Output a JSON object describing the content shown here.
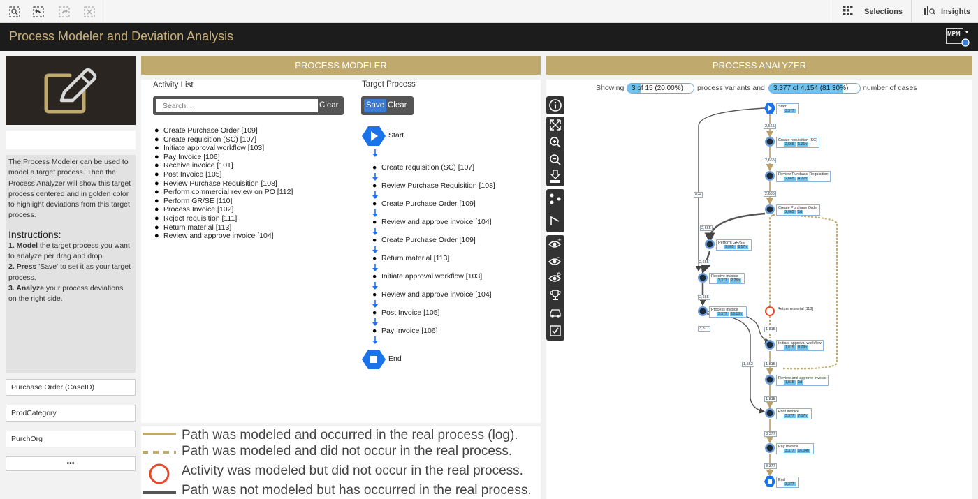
{
  "toolbar": {
    "icons": [
      "smart-search-icon",
      "step-back-icon",
      "step-forward-icon",
      "clear-selections-icon"
    ],
    "selections_label": "Selections",
    "insights_label": "Insights"
  },
  "header": {
    "title": "Process Modeler and Deviation Analysis",
    "logo_text": "MPM"
  },
  "left": {
    "description": "The Process Modeler can be used to model a target process. Then the Process Analyzer will show this target process centered and in golden color to highlight deviations from this target process.",
    "instructions_heading": "Instructions:",
    "steps": [
      {
        "bold": "1. Model",
        "rest": " the target process you want to analyze per drag and drop."
      },
      {
        "bold": "2. Press",
        "rest": " 'Save' to set it as your target process."
      },
      {
        "bold": "3. Analyze",
        "rest": " your process deviations on the right side."
      }
    ],
    "filters": [
      "Purchase Order (CaseID)",
      "ProdCategory",
      "PurchOrg"
    ],
    "more_label": "•••"
  },
  "modeler": {
    "header": "PROCESS MODELER",
    "activity_list_label": "Activity List",
    "search_placeholder": "Search...",
    "search_clear": "Clear",
    "activities": [
      "Create Purchase Order [109]",
      "Create requisition (SC) [107]",
      "Initiate approval workflow [103]",
      "Pay Invoice [106]",
      "Receive invoice [101]",
      "Post Invoice [105]",
      "Review Purchase Requisition [108]",
      "Perform commercial review on PO [112]",
      "Perform GR/SE [110]",
      "Process Invoice [102]",
      "Reject requisition [111]",
      "Return material [113]",
      "Review and approve invoice [104]"
    ],
    "target_label": "Target Process",
    "save_label": "Save",
    "clear_label": "Clear",
    "start_label": "Start",
    "end_label": "End",
    "target_steps": [
      "Create requisition (SC) [107]",
      "Review Purchase Requisition [108]",
      "Create Purchase Order [109]",
      "Review and approve invoice [104]",
      "Create Purchase Order [109]",
      "Return material [113]",
      "Initiate approval workflow [103]",
      "Review and approve invoice [104]",
      "Post Invoice [105]",
      "Pay Invoice [106]"
    ]
  },
  "legend": {
    "rows": [
      "Path was modeled and occurred in the real process (log).",
      "Path was modeled and did not occur in the real process.",
      "Activity was modeled but did not occur in the real process.",
      "Path was not modeled but has occurred in the real process."
    ]
  },
  "analyzer": {
    "header": "PROCESS ANALYZER",
    "showing_label": "Showing",
    "variants_pill": "3 of 15 (20.00%)",
    "variants_fraction": 0.2,
    "variants_suffix": "process variants and",
    "cases_pill": "3,377 of 4,154 (81.30%)",
    "cases_fraction": 0.813,
    "cases_suffix": "number of cases",
    "tools": [
      "info-icon",
      "fit-icon",
      "zoom-in-icon",
      "zoom-out-icon",
      "download-svg-icon",
      "layout-nodes-icon",
      "layout-edges-icon",
      "eye-plus-icon",
      "eye-minus-icon",
      "eye-reset-icon",
      "trophy-icon",
      "car-icon",
      "checkbox-icon"
    ],
    "nodes": [
      {
        "name": "Start",
        "kpi": [
          "3,377"
        ]
      },
      {
        "name": "Create requisition (SC)",
        "kpi": [
          "2,665",
          "1.21h"
        ]
      },
      {
        "name": "Review Purchase Requisition",
        "kpi": [
          "2,665",
          "4.22h"
        ]
      },
      {
        "name": "Create Purchase Order",
        "kpi": [
          "2,665",
          "1d"
        ]
      },
      {
        "name": "Perform GR/SE",
        "kpi": [
          "2,665",
          "6.57h"
        ]
      },
      {
        "name": "Receive invoice",
        "kpi": [
          "3,377",
          "2.25h"
        ]
      },
      {
        "name": "Process invoice",
        "kpi": [
          "3,377",
          "19.13h"
        ]
      },
      {
        "name": "Return material [113]",
        "kpi": []
      },
      {
        "name": "Initiate approval workflow",
        "kpi": [
          "1,815",
          "8.09h"
        ]
      },
      {
        "name": "Review and approve invoice",
        "kpi": [
          "1,815",
          "1d"
        ]
      },
      {
        "name": "Post Invoice",
        "kpi": [
          "3,377",
          "7.17h"
        ]
      },
      {
        "name": "Pay Invoice",
        "kpi": [
          "3,377",
          "16.04h"
        ]
      },
      {
        "name": "End",
        "kpi": [
          "3,377"
        ]
      }
    ],
    "edge_labels": [
      "2,665",
      "2,665",
      "2,665",
      "2,665",
      "2,665",
      "2,665",
      "3,377",
      "1,815",
      "1,815",
      "1,815",
      "1,562",
      "3,377",
      "3,377",
      "824"
    ]
  },
  "colors": {
    "gold": "#c0a96c",
    "accent_blue": "#3a7bd5",
    "dark": "#1c1c1c",
    "kpi_blue": "#6ec3ee",
    "deviation_red": "#e8492a"
  }
}
